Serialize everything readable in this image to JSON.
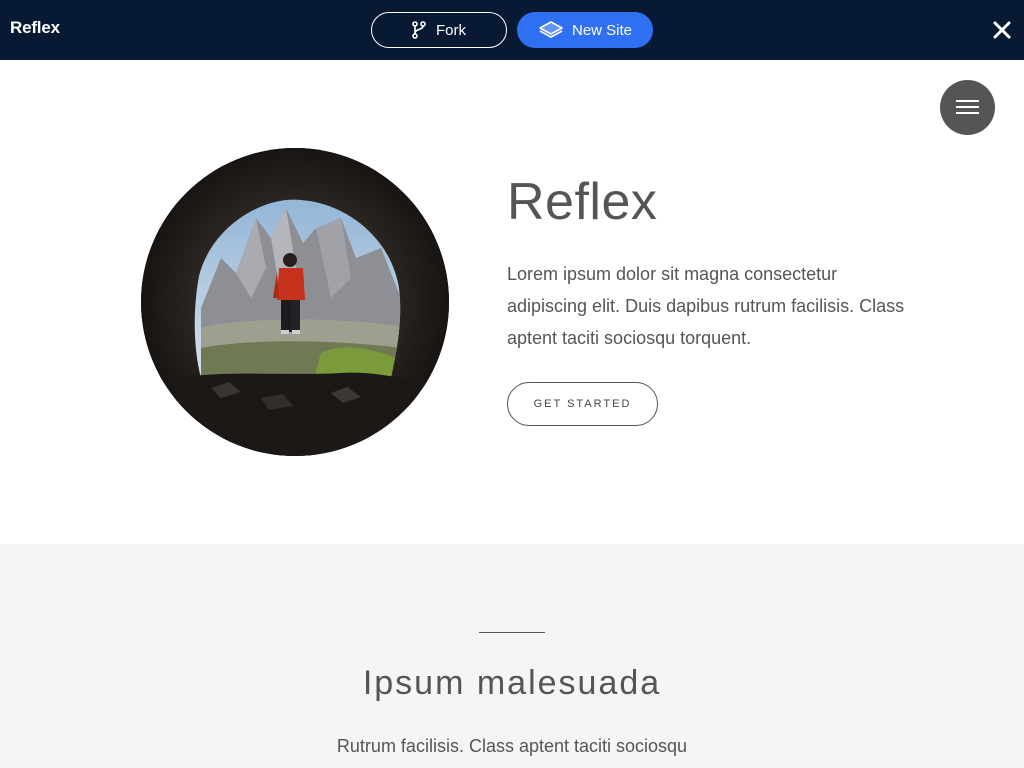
{
  "topbar": {
    "brand": "Reflex",
    "fork_label": "Fork",
    "new_site_label": "New Site"
  },
  "hero": {
    "title": "Reflex",
    "text": "Lorem ipsum dolor sit magna consectetur adipiscing elit. Duis dapibus rutrum facilisis. Class aptent taciti sociosqu torquent.",
    "cta_label": "GET STARTED"
  },
  "section": {
    "title": "Ipsum malesuada",
    "text": "Rutrum facilisis. Class aptent taciti sociosqu"
  },
  "icons": {
    "fork": "git-fork-icon",
    "new_site": "layers-icon",
    "close": "close-icon",
    "menu": "hamburger-icon"
  },
  "colors": {
    "topbar_bg": "#081a33",
    "accent": "#2f6ff2",
    "text": "#555555",
    "section_bg": "#f5f5f5"
  }
}
